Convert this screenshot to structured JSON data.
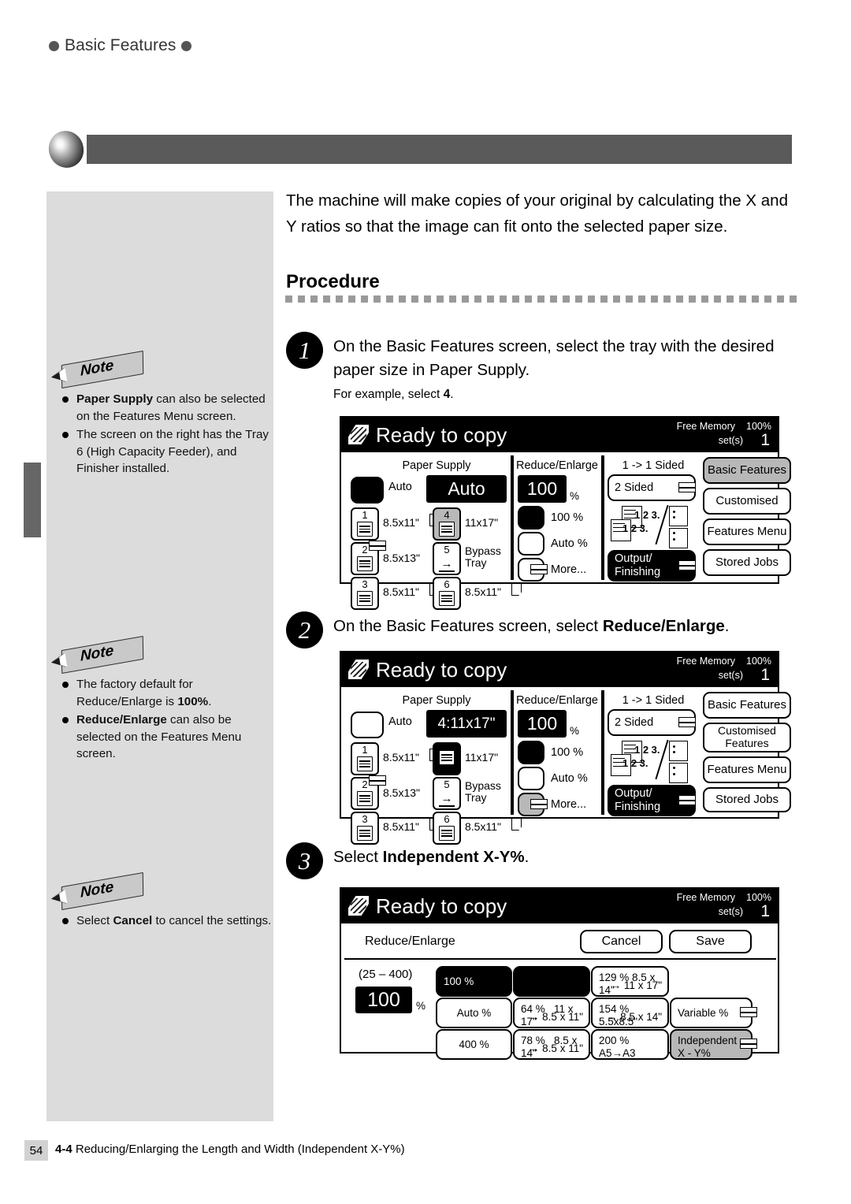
{
  "running_header": {
    "text": "Basic Features"
  },
  "intro": {
    "paragraph": "The machine will make copies of your original by calculating the X and Y ratios so that the image can fit onto the selected paper size."
  },
  "procedure_heading": "Procedure",
  "steps": [
    {
      "number": "1",
      "text_before": "On the Basic Features screen, select the tray with the desired paper size in Paper Supply.",
      "sub_prefix": "For example, select ",
      "sub_bold": "4",
      "sub_suffix": "."
    },
    {
      "number": "2",
      "text_before": "On the Basic Features screen, select ",
      "text_bold": "Reduce/Enlarge",
      "text_after": "."
    },
    {
      "number": "3",
      "text_before": "Select ",
      "text_bold": "Independent X-Y%",
      "text_after": "."
    }
  ],
  "notes": [
    {
      "badge": "Note",
      "items": [
        {
          "bold": "Paper Supply",
          "rest": " can also be selected on the Features Menu screen."
        },
        {
          "bold": "",
          "rest": "The screen on the right has the Tray 6 (High Capacity Feeder), and Finisher installed."
        }
      ]
    },
    {
      "badge": "Note",
      "items": [
        {
          "bold": "",
          "rest": "The factory default for Reduce/Enlarge is ",
          "trailing_bold": "100%",
          "trailing_rest": "."
        },
        {
          "bold": "Reduce/Enlarge",
          "rest": " can also be selected on the Features Menu screen."
        }
      ]
    },
    {
      "badge": "Note",
      "items": [
        {
          "bold": "",
          "rest": "Select ",
          "trailing_bold": "Cancel",
          "trailing_rest": " to cancel the settings."
        }
      ]
    }
  ],
  "screen1": {
    "status": "Ready to copy",
    "free_memory_label": "Free Memory",
    "free_memory_value": "100%",
    "sets_label": "set(s)",
    "sets_value": "1",
    "paper_supply_title": "Paper Supply",
    "reduce_enlarge_title": "Reduce/Enlarge",
    "sided_title": "1 -> 1 Sided",
    "auto_label": "Auto",
    "paper_value": "Auto",
    "ratio_value": "100",
    "ratio_pct": "%",
    "trays": [
      {
        "num": "1",
        "size": "8.5x11\"",
        "sheet": true,
        "state": "normal",
        "glyph": "tray"
      },
      {
        "num": "2",
        "size": "8.5x13\"",
        "sheet": false,
        "state": "normal",
        "glyph": "tray",
        "duplex": true
      },
      {
        "num": "3",
        "size": "8.5x11\"",
        "sheet": true,
        "state": "normal",
        "glyph": "tray"
      },
      {
        "num": "4",
        "size": "11x17\"",
        "sheet": false,
        "state": "selected",
        "glyph": "tray"
      },
      {
        "num": "5",
        "size": "Bypass Tray",
        "sheet": false,
        "state": "normal",
        "glyph": "arrow"
      },
      {
        "num": "6",
        "size": "8.5x11\"",
        "sheet": true,
        "state": "normal",
        "glyph": "tray"
      }
    ],
    "ratio_options": [
      {
        "label": "100 %",
        "state": "black"
      },
      {
        "label": "Auto %",
        "state": "normal"
      },
      {
        "label": "More...",
        "state": "normal",
        "duplex": true
      }
    ],
    "two_sided_label": "2 Sided",
    "output_label_line1": "Output/",
    "output_label_line2": "Finishing",
    "output_num_top": "1 2 3.",
    "output_num_bottom": "1 2 3.",
    "tabs": [
      {
        "label": "Basic Features",
        "state": "active"
      },
      {
        "label": "Customised",
        "state": "normal"
      },
      {
        "label": "Features Menu",
        "state": "normal"
      },
      {
        "label": "Stored Jobs",
        "state": "normal"
      }
    ]
  },
  "screen2": {
    "status": "Ready to copy",
    "free_memory_label": "Free Memory",
    "free_memory_value": "100%",
    "sets_label": "set(s)",
    "sets_value": "1",
    "paper_supply_title": "Paper Supply",
    "reduce_enlarge_title": "Reduce/Enlarge",
    "sided_title": "1 -> 1 Sided",
    "auto_label": "Auto",
    "paper_value": "4:11x17\"",
    "ratio_value": "100",
    "ratio_pct": "%",
    "trays": [
      {
        "num": "1",
        "size": "8.5x11\"",
        "sheet": true,
        "state": "normal",
        "glyph": "tray"
      },
      {
        "num": "2",
        "size": "8.5x13\"",
        "sheet": false,
        "state": "normal",
        "glyph": "tray",
        "duplex": true
      },
      {
        "num": "3",
        "size": "8.5x11\"",
        "sheet": true,
        "state": "normal",
        "glyph": "tray"
      },
      {
        "num": "4",
        "size": "11x17\"",
        "sheet": false,
        "state": "inverted",
        "glyph": "tray"
      },
      {
        "num": "5",
        "size": "Bypass Tray",
        "sheet": false,
        "state": "normal",
        "glyph": "arrow"
      },
      {
        "num": "6",
        "size": "8.5x11\"",
        "sheet": true,
        "state": "normal",
        "glyph": "tray"
      }
    ],
    "ratio_options": [
      {
        "label": "100 %",
        "state": "black"
      },
      {
        "label": "Auto %",
        "state": "normal"
      },
      {
        "label": "More...",
        "state": "gray",
        "duplex": true
      }
    ],
    "two_sided_label": "2 Sided",
    "output_label_line1": "Output/",
    "output_label_line2": "Finishing",
    "output_num_top": "1 2 3.",
    "output_num_bottom": "1 2 3.",
    "tabs": [
      {
        "label": "Basic Features",
        "state": "active_outline"
      },
      {
        "label": "Customised Features",
        "state": "normal"
      },
      {
        "label": "Features Menu",
        "state": "normal"
      },
      {
        "label": "Stored Jobs",
        "state": "normal"
      }
    ]
  },
  "screen3": {
    "status": "Ready to copy",
    "free_memory_label": "Free Memory",
    "free_memory_value": "100%",
    "sets_label": "set(s)",
    "sets_value": "1",
    "dialog_title": "Reduce/Enlarge",
    "cancel_label": "Cancel",
    "save_label": "Save",
    "range_label": "(25 – 400)",
    "current_value": "100",
    "current_pct": "%",
    "ratio_grid": [
      {
        "label": "100 %",
        "state": "black",
        "col": 1,
        "row": 1
      },
      {
        "label": "",
        "state": "black",
        "col": 2,
        "row": 1
      },
      {
        "label_a": "129 %",
        "label_b": "8.5 x 14\"",
        "label_c": "→ 11 x 17\"",
        "state": "normal",
        "col": 3,
        "row": 1
      },
      {
        "label": "Auto %",
        "state": "normal",
        "col": 1,
        "row": 2
      },
      {
        "label_a": "64 %",
        "label_b": "11 x 17\"",
        "label_c": "→ 8.5 x 11\"",
        "state": "normal",
        "col": 2,
        "row": 2
      },
      {
        "label_a": "154 %",
        "label_b": "5.5x8.5\"",
        "label_c": "→ 8.5 x 14\"",
        "state": "normal",
        "col": 3,
        "row": 2
      },
      {
        "label": "400 %",
        "state": "normal",
        "col": 1,
        "row": 3
      },
      {
        "label_a": "78 %",
        "label_b": "8.5 x 14\"",
        "label_c": "→ 8.5 x 11\"",
        "state": "normal",
        "col": 2,
        "row": 3
      },
      {
        "label_a": "200 %",
        "label_b": "A5→A3",
        "label_c": "",
        "state": "normal",
        "col": 3,
        "row": 3
      }
    ],
    "variable_label": "Variable %",
    "independent_label_line1": "Independent",
    "independent_label_line2": "X - Y%"
  },
  "footer": {
    "page_number": "54",
    "section": "4-4",
    "title": "Reducing/Enlarging the Length and Width (Independent X-Y%)"
  }
}
